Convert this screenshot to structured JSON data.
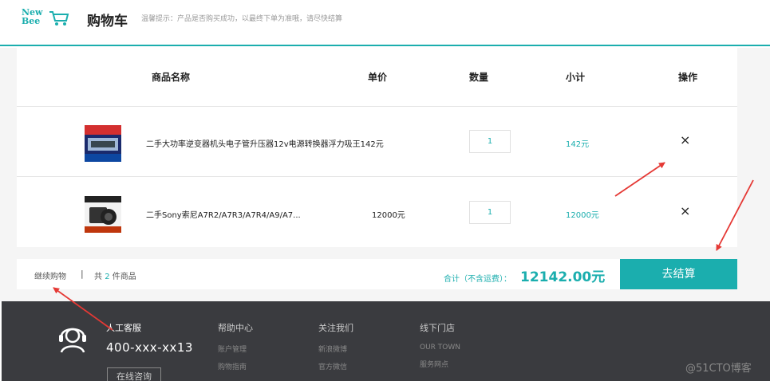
{
  "header": {
    "logo_line1": "New",
    "logo_line2": "Bee",
    "title": "购物车",
    "tip": "温馨提示：产品是否购买成功，以最终下单为准哦，请尽快结算"
  },
  "table": {
    "headers": [
      "商品名称",
      "单价",
      "数量",
      "小计",
      "操作"
    ]
  },
  "items": [
    {
      "name": "二手大功率逆变器机头电子管升压器12v电源转换器浮力吸王142元",
      "price": "",
      "qty": "1",
      "subtotal": "142元",
      "delete": "×"
    },
    {
      "name": "二手Sony索尼A7R2/A7R3/A7R4/A9/A7...",
      "price": "12000元",
      "qty": "1",
      "subtotal": "12000元",
      "delete": "×"
    }
  ],
  "summary": {
    "continue": "继续购物",
    "separator": "|",
    "count_prefix": "共",
    "count": "2",
    "count_suffix": "件商品",
    "total_label": "合计（不含运费）：",
    "total_value": "12142.00元",
    "checkout": "去结算"
  },
  "footer": {
    "cs_label": "人工客服",
    "cs_phone": "400-xxx-xx13",
    "cs_button": "在线咨询",
    "columns": [
      {
        "title": "帮助中心",
        "links": [
          "账户管理",
          "购物指南"
        ]
      },
      {
        "title": "关注我们",
        "links": [
          "新浪微博",
          "官方微信"
        ]
      },
      {
        "title": "线下门店",
        "links": [
          "OUR TOWN",
          "服务网点"
        ]
      }
    ],
    "watermark": "@51CTO博客"
  },
  "colors": {
    "accent": "#1baeae",
    "footer_bg": "#3a3b3f",
    "annotation": "#e53935"
  }
}
